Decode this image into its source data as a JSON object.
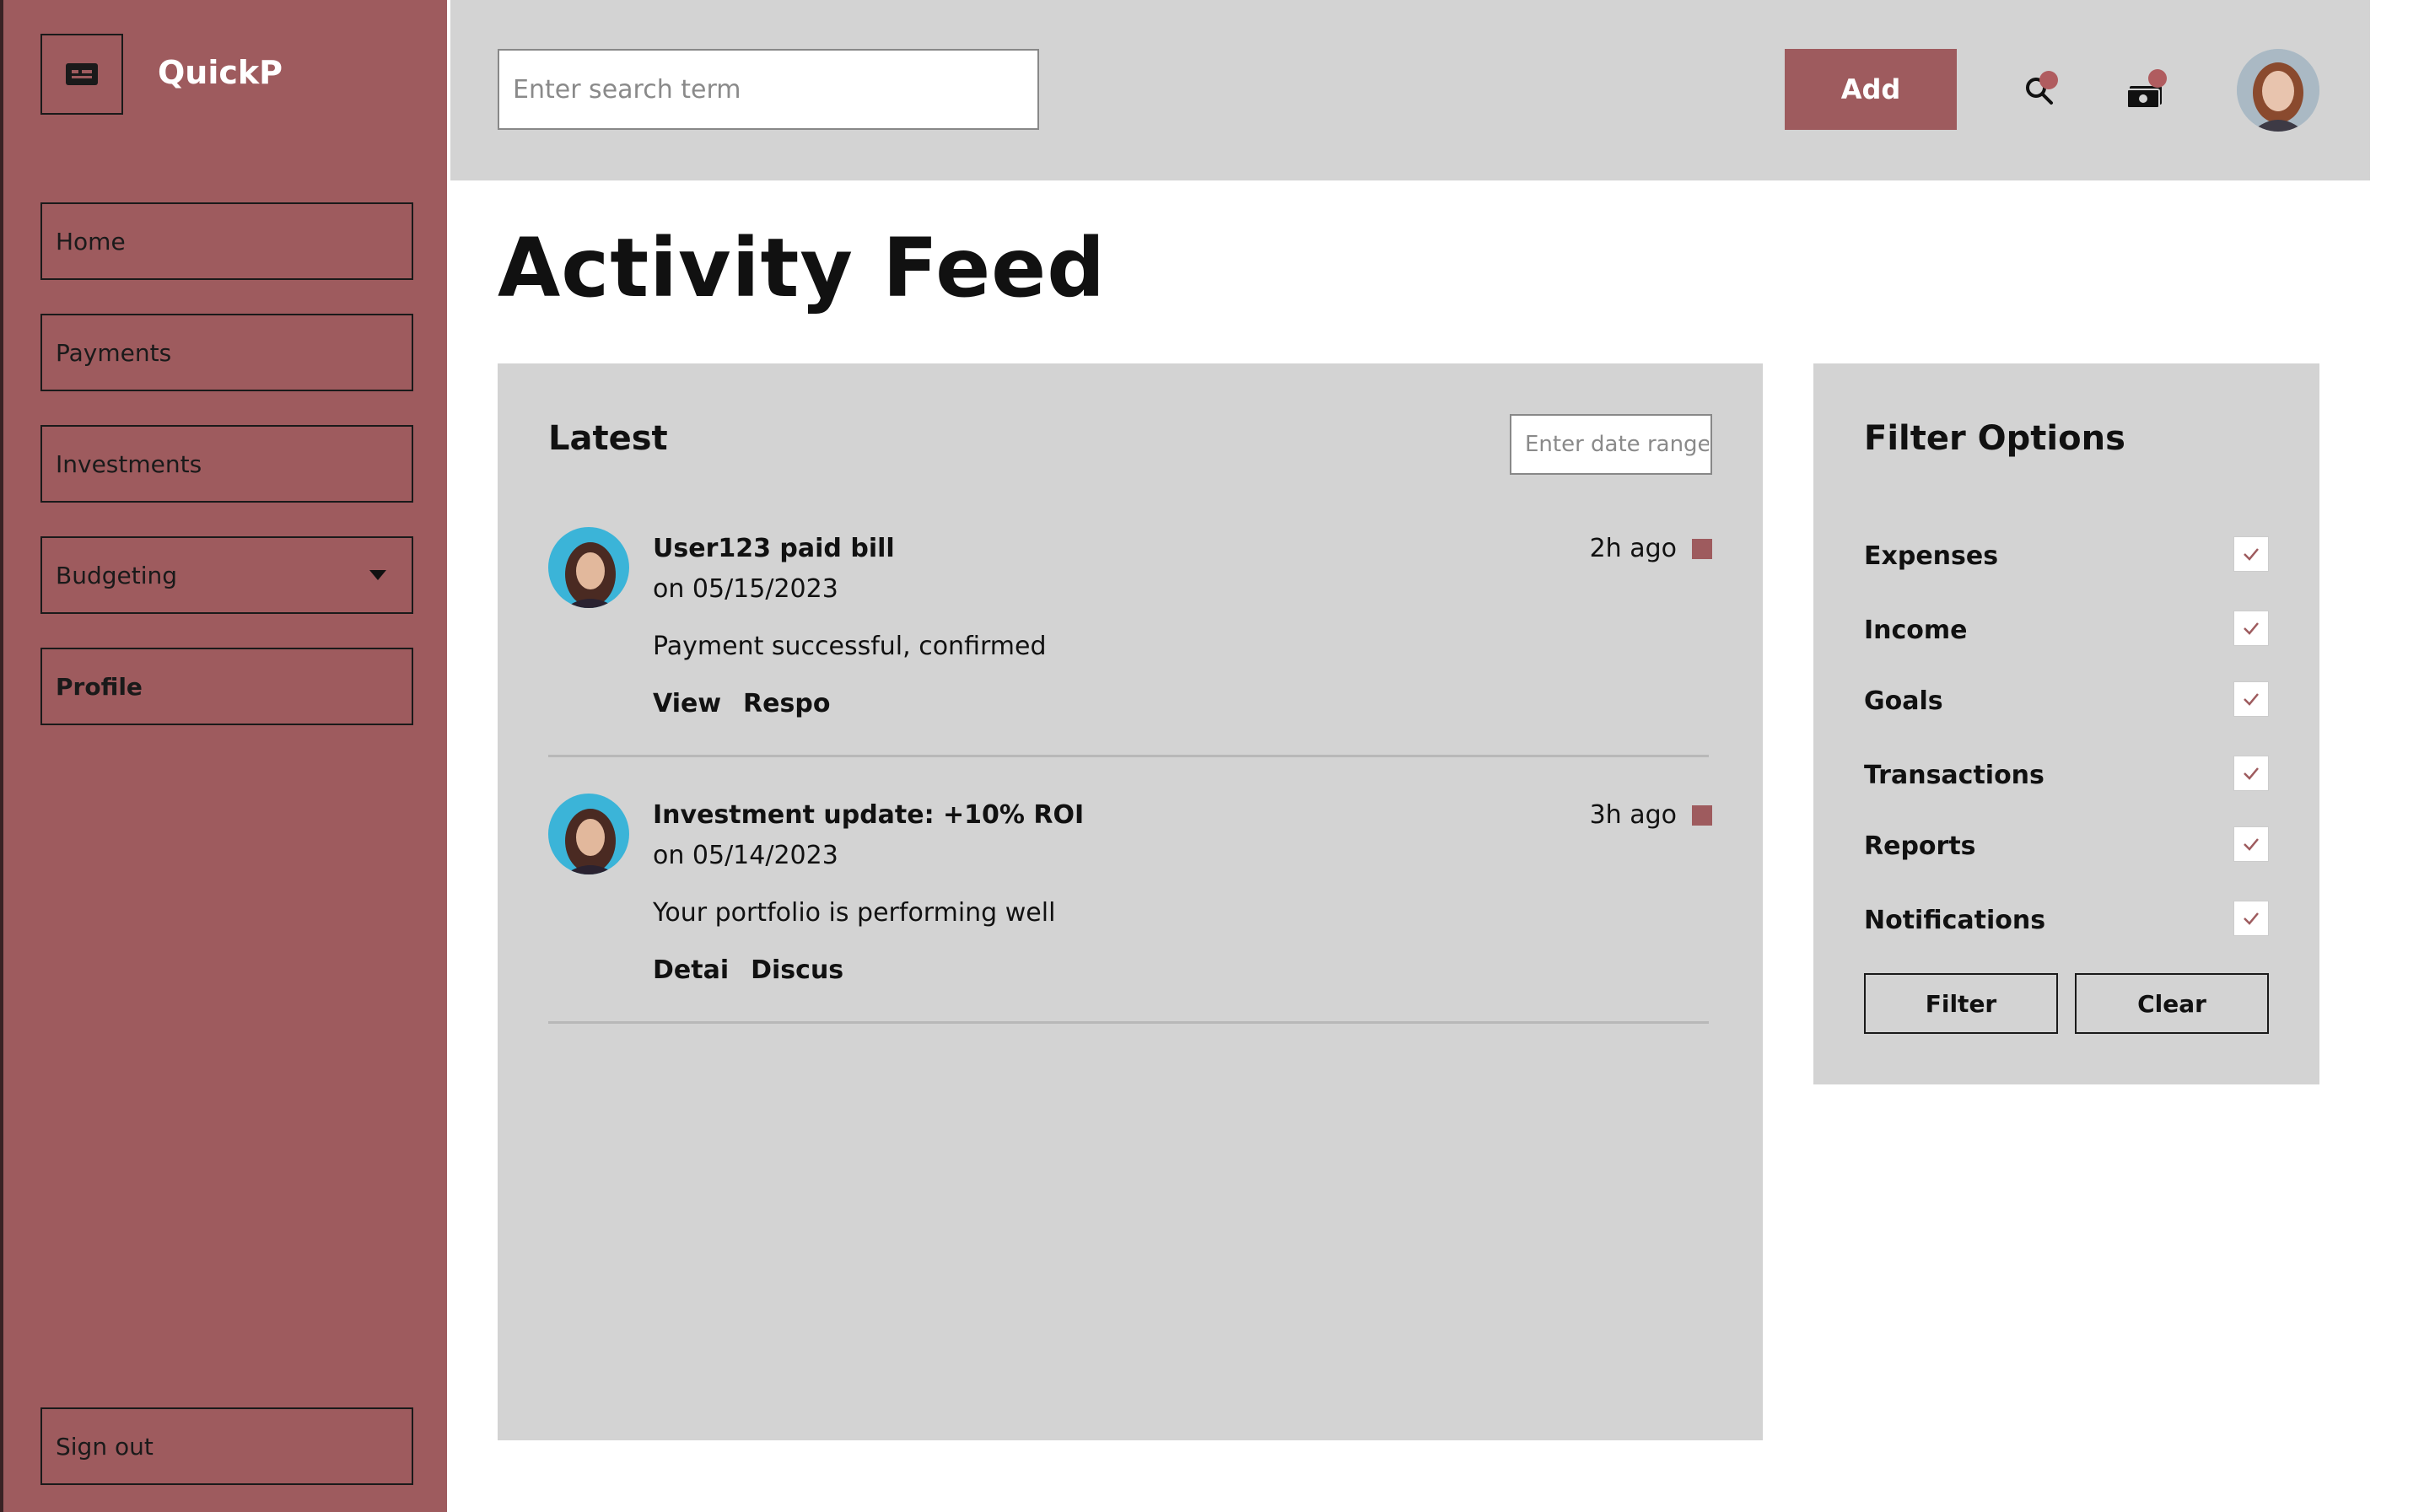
{
  "app": {
    "brand": "QuickP"
  },
  "sidebar": {
    "logo_icon": "id-card-icon",
    "items": [
      {
        "label": "Home"
      },
      {
        "label": "Payments"
      },
      {
        "label": "Investments"
      },
      {
        "label": "Budgeting",
        "has_dropdown": true
      },
      {
        "label": "Profile"
      }
    ],
    "sign_out": "Sign out",
    "color": "#9e5b5e"
  },
  "topbar": {
    "search_placeholder": "Enter search term",
    "add_label": "Add",
    "icons": [
      "search-icon",
      "money-icon"
    ],
    "notification_dot_color": "#b05c5f"
  },
  "main": {
    "title": "Activity Feed"
  },
  "feed": {
    "title": "Latest",
    "date_placeholder": "Enter date range",
    "items": [
      {
        "title": "User123 paid bill",
        "date": "on 05/15/2023",
        "desc": "Payment successful, confirmed",
        "time": "2h ago",
        "actions": [
          "View",
          "Respo"
        ]
      },
      {
        "title": "Investment update: +10% ROI",
        "date": "on 05/14/2023",
        "desc": "Your portfolio is performing well",
        "time": "3h ago",
        "actions": [
          "Detai",
          "Discus"
        ]
      }
    ]
  },
  "filters": {
    "title": "Filter Options",
    "options": [
      {
        "label": "Expenses",
        "checked": true
      },
      {
        "label": "Income",
        "checked": true
      },
      {
        "label": "Goals",
        "checked": true
      },
      {
        "label": "Transactions",
        "checked": true
      },
      {
        "label": "Reports",
        "checked": true
      },
      {
        "label": "Notifications",
        "checked": true
      }
    ],
    "filter_button": "Filter",
    "clear_button": "Clear"
  }
}
